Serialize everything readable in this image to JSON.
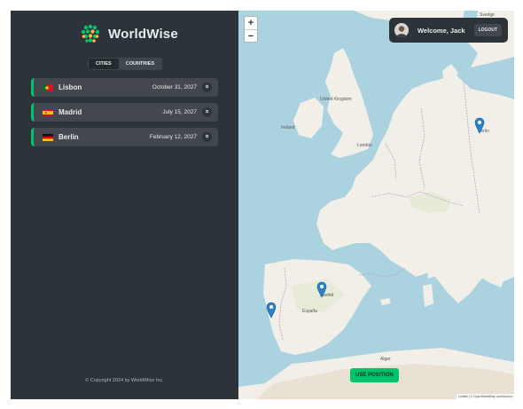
{
  "app": {
    "name": "WorldWise"
  },
  "tabs": [
    {
      "label": "CITIES",
      "active": true
    },
    {
      "label": "COUNTRIES",
      "active": false
    }
  ],
  "cities": [
    {
      "name": "Lisbon",
      "date": "October 31, 2027",
      "flag": "portugal",
      "delete_label": "×"
    },
    {
      "name": "Madrid",
      "date": "July 15, 2027",
      "flag": "spain",
      "delete_label": "×"
    },
    {
      "name": "Berlin",
      "date": "February 12, 2027",
      "flag": "germany",
      "delete_label": "×"
    }
  ],
  "footer": {
    "copyright": "© Copyright 2024 by WorldWise Inc."
  },
  "map": {
    "zoom_in": "+",
    "zoom_out": "−",
    "use_position": "USE POSITION",
    "attribution": "Leaflet | © OpenStreetMap contributors",
    "labels": {
      "ireland": "Ireland",
      "united_kingdom": "United Kingdom",
      "london": "London",
      "espana": "España",
      "madrid": "Madrid",
      "berlin": "Berlin",
      "sverige": "Sverige",
      "alger": "Alger"
    }
  },
  "user": {
    "welcome": "Welcome, Jack",
    "logout": "LOGOUT"
  },
  "colors": {
    "accent": "#00c46a",
    "sidebar": "#2d3439",
    "item": "#42484d",
    "sea": "#aad3df",
    "land": "#f2efe9"
  }
}
